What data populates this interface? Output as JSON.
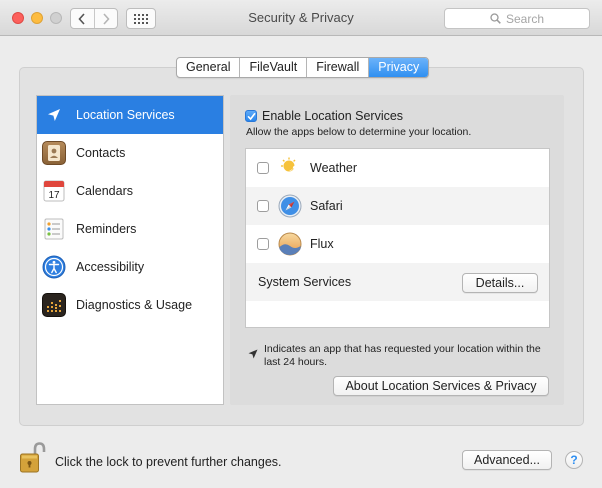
{
  "window": {
    "title": "Security & Privacy",
    "search_placeholder": "Search"
  },
  "tabs": [
    {
      "label": "General",
      "active": false
    },
    {
      "label": "FileVault",
      "active": false
    },
    {
      "label": "Firewall",
      "active": false
    },
    {
      "label": "Privacy",
      "active": true
    }
  ],
  "sidebar": {
    "items": [
      {
        "label": "Location Services",
        "icon": "location-arrow-icon",
        "selected": true
      },
      {
        "label": "Contacts",
        "icon": "contacts-book-icon",
        "selected": false
      },
      {
        "label": "Calendars",
        "icon": "calendar-icon",
        "selected": false,
        "icon_text": "17"
      },
      {
        "label": "Reminders",
        "icon": "reminders-list-icon",
        "selected": false
      },
      {
        "label": "Accessibility",
        "icon": "accessibility-person-icon",
        "selected": false
      },
      {
        "label": "Diagnostics & Usage",
        "icon": "diagnostics-grid-icon",
        "selected": false
      }
    ]
  },
  "location": {
    "enable_label": "Enable Location Services",
    "enabled": true,
    "subtext": "Allow the apps below to determine your location.",
    "apps": [
      {
        "label": "Weather",
        "checked": false,
        "icon": "weather-sun-icon"
      },
      {
        "label": "Safari",
        "checked": false,
        "icon": "safari-compass-icon"
      },
      {
        "label": "Flux",
        "checked": false,
        "icon": "flux-icon"
      }
    ],
    "system_services_label": "System Services",
    "details_button": "Details...",
    "note_text": "Indicates an app that has requested your location within the last 24 hours.",
    "about_button": "About Location Services & Privacy"
  },
  "footer": {
    "lock_text": "Click the lock to prevent further changes.",
    "advanced_button": "Advanced...",
    "help_label": "?"
  },
  "colors": {
    "selection": "#2a7fe2",
    "tab_active": "#2f8ff1",
    "close": "#fc605c",
    "minimize": "#fdbc40"
  }
}
